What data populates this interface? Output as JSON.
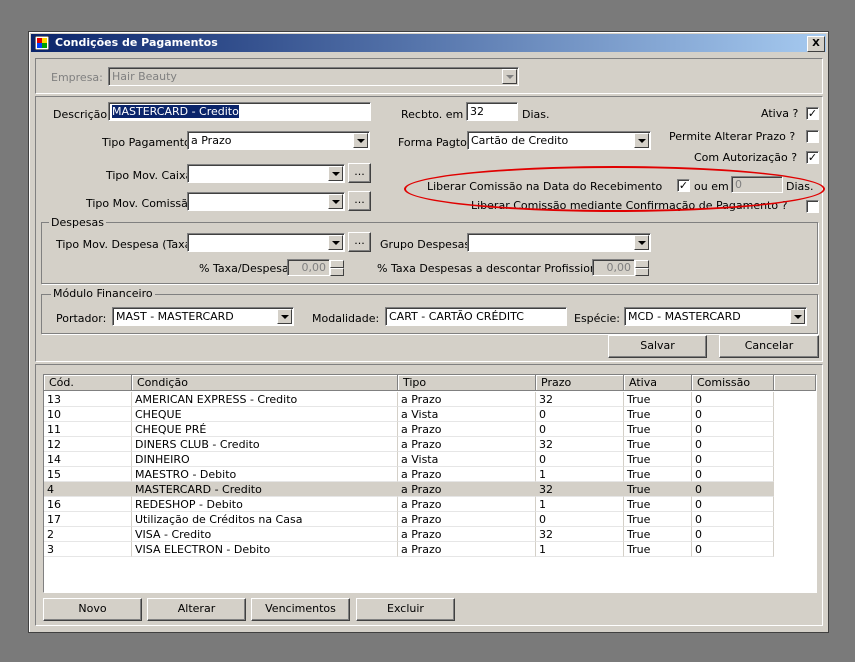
{
  "window": {
    "title": "Condições de Pagamentos",
    "close_label": "X"
  },
  "empresa": {
    "label": "Empresa:",
    "value": "Hair Beauty"
  },
  "form": {
    "descricao_label": "Descrição:",
    "descricao_value": "MASTERCARD - Credito",
    "recbto_label": "Recbto. em",
    "recbto_value": "32",
    "dias_label": "Dias.",
    "ativa_label": "Ativa ?",
    "tipo_pagamento_label": "Tipo Pagamento:",
    "tipo_pagamento_value": "a Prazo",
    "forma_pagto_label": "Forma Pagto.:",
    "forma_pagto_value": "Cartão de Credito",
    "permite_alterar_label": "Permite Alterar Prazo ?",
    "com_autorizacao_label": "Com Autorização ?",
    "tipo_mov_caixa_label": "Tipo Mov. Caixa:",
    "tipo_mov_comissao_label": "Tipo Mov. Comissão:",
    "ellipsis": "...",
    "liberar_data_label": "Liberar Comissão na Data do Recebimento",
    "ou_em_label": "ou em",
    "ou_em_value": "0",
    "dias2_label": "Dias.",
    "liberar_confirm_label": "Liberar Comissão mediante Confirmação de Pagamento ?"
  },
  "despesas": {
    "title": "Despesas",
    "tipo_mov_label": "Tipo Mov. Despesa (Taxa):",
    "grupo_label": "Grupo Despesas:",
    "taxa_label": "% Taxa/Despesa:",
    "taxa_value": "0,00",
    "taxa_prof_label": "% Taxa Despesas a descontar Profissional:",
    "taxa_prof_value": "0,00"
  },
  "financeiro": {
    "title": "Módulo Financeiro",
    "portador_label": "Portador:",
    "portador_value": "MAST - MASTERCARD",
    "modalidade_label": "Modalidade:",
    "modalidade_value": "CART - CARTÃO CRÉDITC",
    "especie_label": "Espécie:",
    "especie_value": "MCD - MASTERCARD"
  },
  "buttons": {
    "salvar": "Salvar",
    "cancelar": "Cancelar",
    "novo": "Novo",
    "alterar": "Alterar",
    "vencimentos": "Vencimentos",
    "excluir": "Excluir"
  },
  "grid": {
    "headers": [
      "Cód.",
      "Condição",
      "Tipo",
      "Prazo",
      "Ativa",
      "Comissão"
    ],
    "rows": [
      [
        "13",
        "AMERICAN EXPRESS - Credito",
        "a Prazo",
        "32",
        "True",
        "0"
      ],
      [
        "10",
        "CHEQUE",
        "a Vista",
        "0",
        "True",
        "0"
      ],
      [
        "11",
        "CHEQUE PRÉ",
        "a Prazo",
        "0",
        "True",
        "0"
      ],
      [
        "12",
        "DINERS CLUB - Credito",
        "a Prazo",
        "32",
        "True",
        "0"
      ],
      [
        "14",
        "DINHEIRO",
        "a Vista",
        "0",
        "True",
        "0"
      ],
      [
        "15",
        "MAESTRO - Debito",
        "a Prazo",
        "1",
        "True",
        "0"
      ],
      [
        "4",
        "MASTERCARD - Credito",
        "a Prazo",
        "32",
        "True",
        "0"
      ],
      [
        "16",
        "REDESHOP - Debito",
        "a Prazo",
        "1",
        "True",
        "0"
      ],
      [
        "17",
        "Utilização de Créditos na Casa",
        "a Prazo",
        "0",
        "True",
        "0"
      ],
      [
        "2",
        "VISA - Credito",
        "a Prazo",
        "32",
        "True",
        "0"
      ],
      [
        "3",
        "VISA ELECTRON - Debito",
        "a Prazo",
        "1",
        "True",
        "0"
      ]
    ]
  },
  "checks": {
    "ativa": "✓",
    "permite_alterar": "",
    "com_autorizacao": "✓",
    "liberar_data": "✓",
    "liberar_confirm": ""
  }
}
